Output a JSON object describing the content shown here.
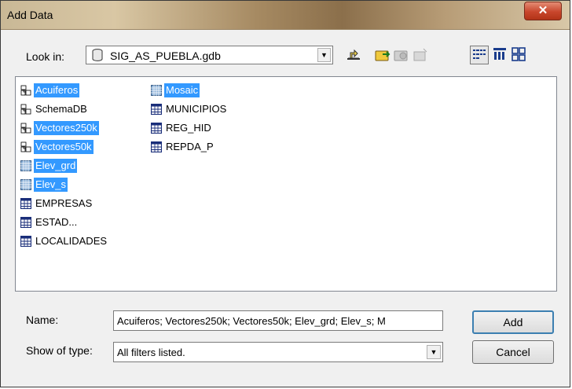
{
  "window": {
    "title": "Add Data",
    "close_glyph": "✕"
  },
  "lookin": {
    "label": "Look in:",
    "value": "SIG_AS_PUEBLA.gdb",
    "icon": "database-icon"
  },
  "toolbar": {
    "buttons": [
      "up-one-level-icon",
      "connect-folder-icon",
      "disconnect-folder-icon",
      "new-item-icon",
      "list-view-icon",
      "details-view-icon",
      "thumbnails-view-icon"
    ]
  },
  "files": [
    {
      "name": "Acuiferos",
      "type": "feature-dataset",
      "selected": true
    },
    {
      "name": "SchemaDB",
      "type": "feature-dataset",
      "selected": false
    },
    {
      "name": "Vectores250k",
      "type": "feature-dataset",
      "selected": true
    },
    {
      "name": "Vectores50k",
      "type": "feature-dataset",
      "selected": true
    },
    {
      "name": "Elev_grd",
      "type": "raster",
      "selected": true
    },
    {
      "name": "Elev_s",
      "type": "raster",
      "selected": true
    },
    {
      "name": "EMPRESAS",
      "type": "table",
      "selected": false
    },
    {
      "name": "ESTAD...",
      "type": "table",
      "selected": false
    },
    {
      "name": "LOCALIDADES",
      "type": "table",
      "selected": false
    },
    {
      "name": "Mosaic",
      "type": "raster",
      "selected": true
    },
    {
      "name": "MUNICIPIOS",
      "type": "table",
      "selected": false
    },
    {
      "name": "REG_HID",
      "type": "table",
      "selected": false
    },
    {
      "name": "REPDA_P",
      "type": "table",
      "selected": false
    }
  ],
  "name_field": {
    "label": "Name:",
    "value": "Acuiferos; Vectores250k; Vectores50k; Elev_grd; Elev_s; M"
  },
  "type_field": {
    "label": "Show of type:",
    "value": "All filters listed."
  },
  "buttons": {
    "add": "Add",
    "cancel": "Cancel"
  },
  "colors": {
    "selection": "#3399ff",
    "close_button": "#c8462c"
  }
}
